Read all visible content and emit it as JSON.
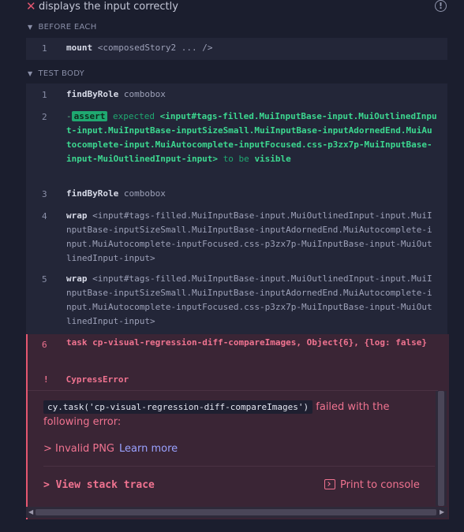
{
  "header": {
    "title": "displays the input correctly"
  },
  "sections": {
    "before_each": "BEFORE EACH",
    "test_body": "TEST BODY"
  },
  "before_each": [
    {
      "num": "1",
      "cmd": "mount",
      "arg": "<composedStory2 ... />"
    }
  ],
  "steps": [
    {
      "num": "1",
      "cmd": "findByRole",
      "arg": "combobox"
    },
    {
      "num": "2",
      "prefix": "-",
      "badge": "assert",
      "expected": "expected",
      "subject": "<input#tags-filled.MuiInputBase-input.MuiOutlinedInput-input.MuiInputBase-inputSizeSmall.MuiInputBase-inputAdornedEnd.MuiAutocomplete-input.MuiAutocomplete-inputFocused.css-p3zx7p-MuiInputBase-input-MuiOutlinedInput-input>",
      "to_be": "to be",
      "visible": "visible"
    },
    {
      "num": "3",
      "cmd": "findByRole",
      "arg": "combobox"
    },
    {
      "num": "4",
      "cmd": "wrap",
      "arg": "<input#tags-filled.MuiInputBase-input.MuiOutlinedInput-input.MuiInputBase-inputSizeSmall.MuiInputBase-inputAdornedEnd.MuiAutocomplete-input.MuiAutocomplete-inputFocused.css-p3zx7p-MuiInputBase-input-MuiOutlinedInput-input>"
    },
    {
      "num": "5",
      "cmd": "wrap",
      "arg": "<input#tags-filled.MuiInputBase-input.MuiOutlinedInput-input.MuiInputBase-inputSizeSmall.MuiInputBase-inputAdornedEnd.MuiAutocomplete-input.MuiAutocomplete-inputFocused.css-p3zx7p-MuiInputBase-input-MuiOutlinedInput-input>"
    },
    {
      "num": "6",
      "cmd": "task",
      "arg": "cp-visual-regression-diff-compareImages, Object{6}, {log: false}"
    }
  ],
  "error": {
    "bang": "!",
    "name": "CypressError",
    "code": "cy.task('cp-visual-regression-diff-compareImages')",
    "message_tail": "failed with the following error:",
    "invalid": "> Invalid PNG",
    "learn_more": "Learn more",
    "stack_trace": "> View stack trace",
    "print_console": "Print to console"
  },
  "colors": {
    "failed": "#e45770",
    "passed": "#1fa971",
    "background": "#1b1e2e"
  }
}
